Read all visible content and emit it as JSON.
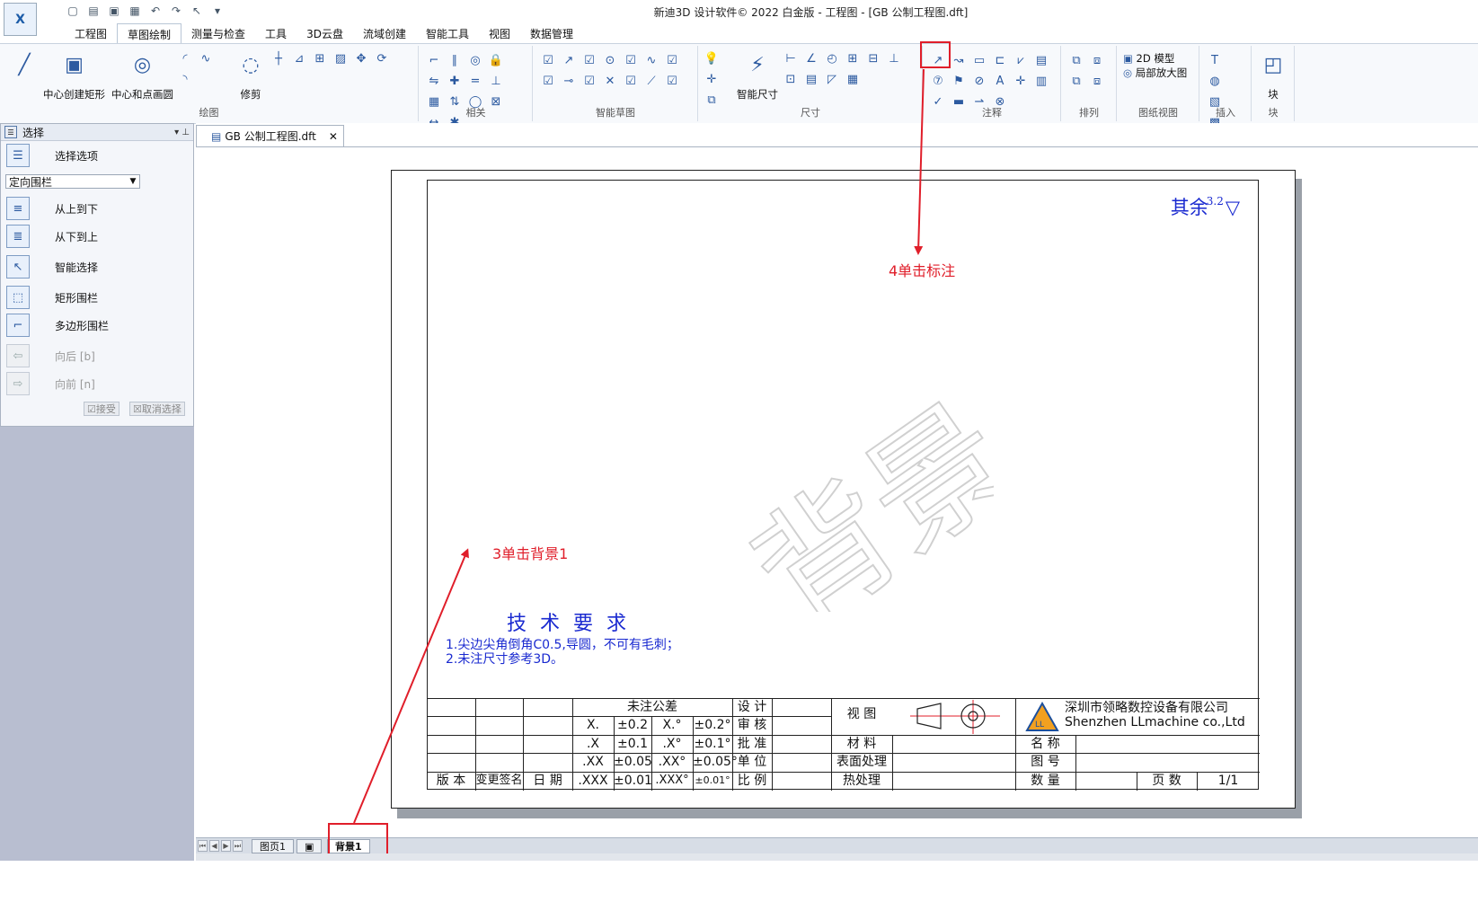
{
  "app": {
    "logo_text": "X",
    "window_title": "新迪3D 设计软件© 2022 白金版 - 工程图 - [GB 公制工程图.dft]"
  },
  "quick_tools": [
    "new-icon",
    "open-icon",
    "save-icon",
    "save-all-icon",
    "undo-icon",
    "redo-icon",
    "select-icon",
    "dropdown-icon"
  ],
  "ribbon_tabs": [
    "工程图",
    "草图绘制",
    "测量与检查",
    "工具",
    "3D云盘",
    "流域创建",
    "智能工具",
    "视图",
    "数据管理"
  ],
  "active_tab": "草图绘制",
  "ribbon": {
    "groups": [
      {
        "label": "绘图",
        "big": [
          "中心创建矩形",
          "中心和点画圆",
          "修剪"
        ]
      },
      {
        "label": "相关",
        "big": []
      },
      {
        "label": "智能草图",
        "big": []
      },
      {
        "label": "尺寸",
        "big": [
          "智能尺寸"
        ]
      },
      {
        "label": "注释",
        "big": []
      },
      {
        "label": "排列",
        "big": []
      },
      {
        "label": "图纸视图",
        "big": [
          "2D 模型",
          "局部放大图"
        ]
      },
      {
        "label": "插入",
        "big": []
      },
      {
        "label": "块",
        "big": [
          "块"
        ]
      }
    ]
  },
  "panel": {
    "title": "选择",
    "items": [
      "选择选项",
      "从上到下",
      "从下到上",
      "智能选择",
      "矩形围栏",
      "多边形围栏",
      "向后 [b]",
      "向前 [n]"
    ],
    "mode_value": "定向围栏",
    "accept": "接受",
    "cancel": "取消选择"
  },
  "document": {
    "tab": "GB 公制工程图.dft",
    "rough_note": "其余",
    "rough_value": "3.2",
    "watermark": "背景",
    "tech_title": "技 术 要 求",
    "tech_lines": [
      "1.尖边尖角倒角C0.5,导圆，不可有毛刺；",
      "2.未注尺寸参考3D。"
    ],
    "title_block": {
      "tol_header": "未注公差",
      "tol_rows": [
        [
          "X.",
          "±0.2",
          "X.°",
          "±0.2°"
        ],
        [
          ".X",
          "±0.1",
          ".X°",
          "±0.1°"
        ],
        [
          ".XX",
          "±0.05",
          ".XX°",
          "±0.05°"
        ],
        [
          ".XXX",
          "±0.01",
          ".XXX°",
          "±0.01°"
        ]
      ],
      "left_bottom": [
        "版 本",
        "变更签名",
        "日 期"
      ],
      "roles": [
        "设 计",
        "审 核",
        "批 准",
        "单 位",
        "比 例"
      ],
      "view_label": "视 图",
      "material": "材 料",
      "surface": "表面处理",
      "heat": "热处理",
      "company_cn": "深圳市领略数控设备有限公司",
      "company_en": "Shenzhen LLmachine co.,Ltd",
      "name": "名 称",
      "drawing_no": "图 号",
      "qty": "数 量",
      "pages_label": "页 数",
      "pages_value": "1/1"
    }
  },
  "sheet_tabs": [
    "图页1",
    "背景1"
  ],
  "annotations": {
    "step3": "3单击背景1",
    "step4": "4单击标注",
    "color": "#e01e2a"
  }
}
